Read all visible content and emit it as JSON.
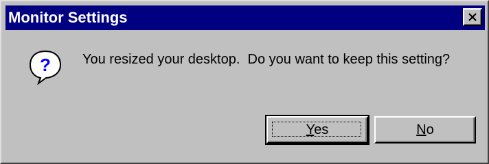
{
  "window": {
    "title": "Monitor Settings",
    "close_icon": "close-icon"
  },
  "message": {
    "icon": "question-icon",
    "text": "You resized your desktop.  Do you want to keep this setting?"
  },
  "buttons": {
    "yes_label": "Yes",
    "yes_mnemonic": "Y",
    "yes_rest": "es",
    "no_label": "No",
    "no_mnemonic": "N",
    "no_rest": "o",
    "default": "yes"
  },
  "colors": {
    "titlebar": "#000080",
    "face": "#c0c0c0",
    "icon_bubble": "#ffffff",
    "icon_glyph": "#0000ff"
  }
}
